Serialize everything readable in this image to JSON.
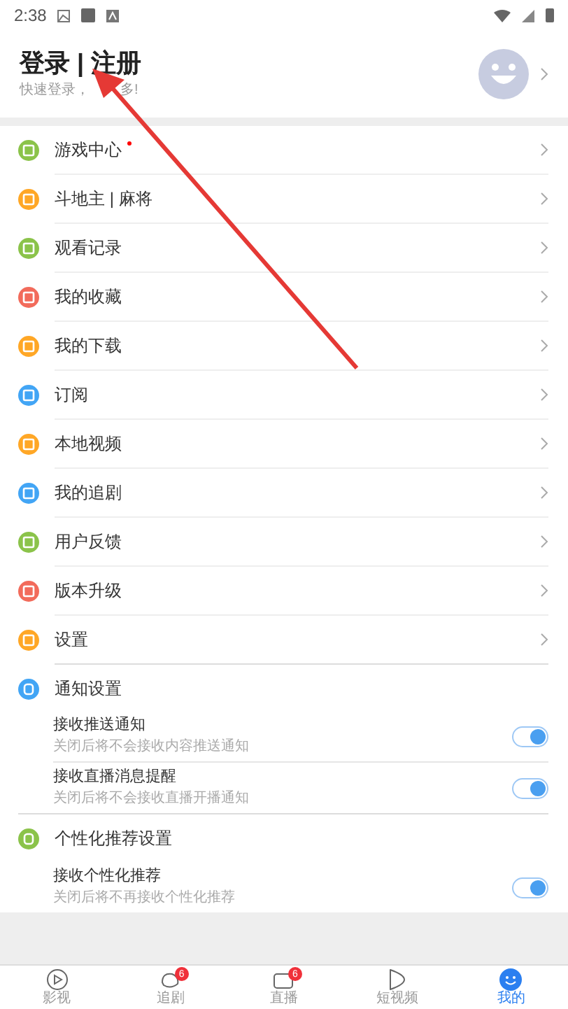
{
  "status_bar": {
    "time": "2:38"
  },
  "header": {
    "title": "登录 | 注册",
    "subtitle_parts": [
      "快速登录，",
      "多!"
    ]
  },
  "menu": [
    {
      "label": "游戏中心",
      "color": "#8bc34a",
      "dot": true
    },
    {
      "label": "斗地主 | 麻将",
      "color": "#ffa726",
      "dot": false
    },
    {
      "label": "观看记录",
      "color": "#8bc34a",
      "dot": false
    },
    {
      "label": "我的收藏",
      "color": "#f26b5b",
      "dot": false
    },
    {
      "label": "我的下载",
      "color": "#ffa726",
      "dot": false
    },
    {
      "label": "订阅",
      "color": "#42a5f5",
      "dot": false
    },
    {
      "label": "本地视频",
      "color": "#ffa726",
      "dot": false
    },
    {
      "label": "我的追剧",
      "color": "#42a5f5",
      "dot": false
    },
    {
      "label": "用户反馈",
      "color": "#8bc34a",
      "dot": false
    },
    {
      "label": "版本升级",
      "color": "#f26b5b",
      "dot": false
    },
    {
      "label": "设置",
      "color": "#ffa726",
      "dot": false
    }
  ],
  "settings": [
    {
      "title": "通知设置",
      "color": "#42a5f5",
      "options": [
        {
          "label": "接收推送通知",
          "description": "关闭后将不会接收内容推送通知",
          "on": true
        },
        {
          "label": "接收直播消息提醒",
          "description": "关闭后将不会接收直播开播通知",
          "on": true
        }
      ]
    },
    {
      "title": "个性化推荐设置",
      "color": "#8bc34a",
      "options": [
        {
          "label": "接收个性化推荐",
          "description": "关闭后将不再接收个性化推荐",
          "on": true
        }
      ]
    }
  ],
  "bottom_nav": [
    {
      "label": "影视",
      "selected": false
    },
    {
      "label": "追剧",
      "badge": "6",
      "selected": false
    },
    {
      "label": "直播",
      "badge": "6",
      "selected": false
    },
    {
      "label": "短视频",
      "selected": false
    },
    {
      "label": "我的",
      "selected": true
    }
  ]
}
